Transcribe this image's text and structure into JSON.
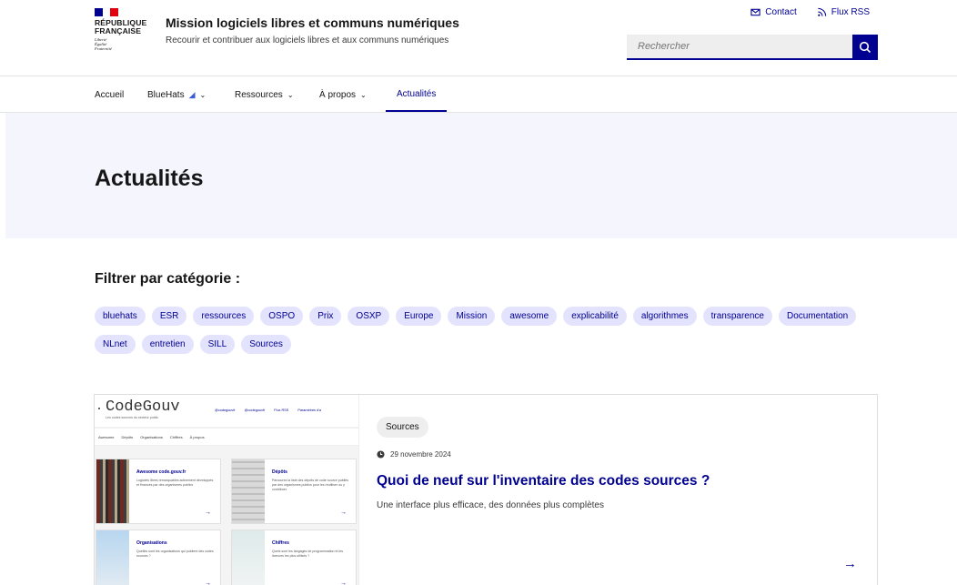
{
  "colors": {
    "primary": "#000091",
    "tag_bg": "#e3e3fd",
    "hero_bg": "#f5f5fe",
    "flag_blue": "#000091",
    "flag_red": "#e1000f"
  },
  "brand": {
    "marianne": [
      "RÉPUBLIQUE",
      "FRANÇAISE"
    ],
    "devise": [
      "Liberté",
      "Égalité",
      "Fraternité"
    ],
    "site_title": "Mission logiciels libres et communs numériques",
    "tagline": "Recourir et contribuer aux logiciels libres et aux communs numériques"
  },
  "tools": {
    "contact": "Contact",
    "rss": "Flux RSS"
  },
  "search": {
    "placeholder": "Rechercher",
    "icon": "search-icon"
  },
  "nav": {
    "items": [
      {
        "label": "Accueil"
      },
      {
        "label": "BlueHats",
        "icon": "blue-hat-icon"
      },
      {
        "label": "Ressources"
      },
      {
        "label": "À propos"
      },
      {
        "label": "Actualités",
        "active": true
      }
    ]
  },
  "hero": {
    "title": "Actualités"
  },
  "filters": {
    "title": "Filtrer par catégorie :",
    "tags": [
      "bluehats",
      "ESR",
      "ressources",
      "OSPO",
      "Prix",
      "OSXP",
      "Europe",
      "Mission",
      "awesome",
      "explicabilité",
      "algorithmes",
      "transparence",
      "Documentation",
      "NLnet",
      "entretien",
      "SILL",
      "Sources"
    ]
  },
  "article": {
    "badge": "Sources",
    "date": "29 novembre 2024",
    "title": "Quoi de neuf sur l'inventaire des codes sources ?",
    "description": "Une interface plus efficace, des données plus complètes",
    "thumbnail": {
      "logo": "CodeGouv",
      "subtitle": "Les codes sources du secteur public",
      "links": [
        "@codegouvfr",
        "@codegouvfr",
        "Flux RSS",
        "Paramètres d'a"
      ],
      "nav": [
        "Awesome",
        "Dépôts",
        "Organisations",
        "Chiffres",
        "À propos"
      ],
      "tiles": [
        {
          "title": "Awesome code.gouv.fr",
          "text": "Logiciels libres remarquables activement développés et financés par des organismes publics"
        },
        {
          "title": "Dépôts",
          "text": "Parcourez la liste des dépôts de code source publiés par des organismes publics pour les réutiliser ou y contribuer."
        },
        {
          "title": "Organisations",
          "text": "Quelles sont les organisations qui publient des codes sources ?"
        },
        {
          "title": "Chiffres",
          "text": "Quels sont les langages de programmation et les licences les plus utilisés ?"
        }
      ]
    }
  }
}
